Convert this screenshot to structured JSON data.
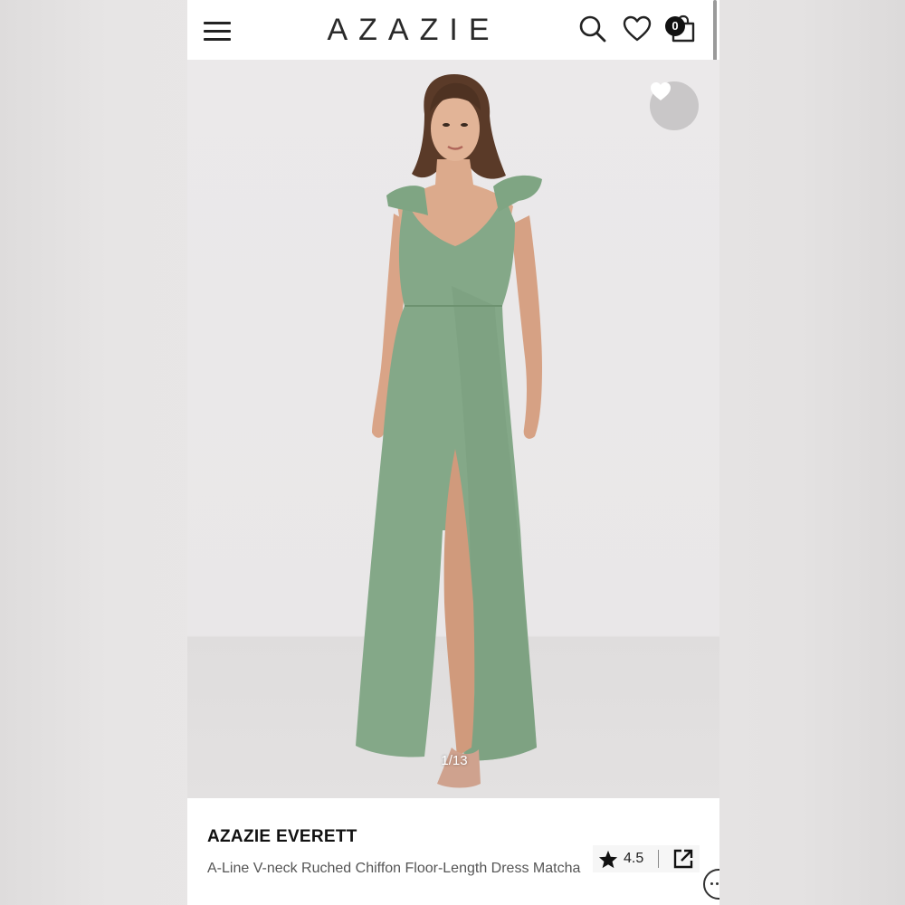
{
  "header": {
    "brand_logo": "AZAZIE",
    "menu_icon": "hamburger-menu-icon",
    "search_icon": "search-icon",
    "wishlist_icon": "heart-icon",
    "cart_icon": "shopping-bag-icon",
    "cart_count": "0"
  },
  "gallery": {
    "counter": "1/13",
    "favorite_icon": "heart-icon"
  },
  "product": {
    "name": "AZAZIE EVERETT",
    "description": "A-Line V-neck Ruched Chiffon Floor-Length Dress Matcha",
    "rating": "4.5",
    "rating_icon": "star-icon",
    "share_icon": "share-external-icon"
  },
  "colors": {
    "dress": "#84a888",
    "background": "#ebe9ea",
    "text_primary": "#111111",
    "text_secondary": "#555555"
  }
}
